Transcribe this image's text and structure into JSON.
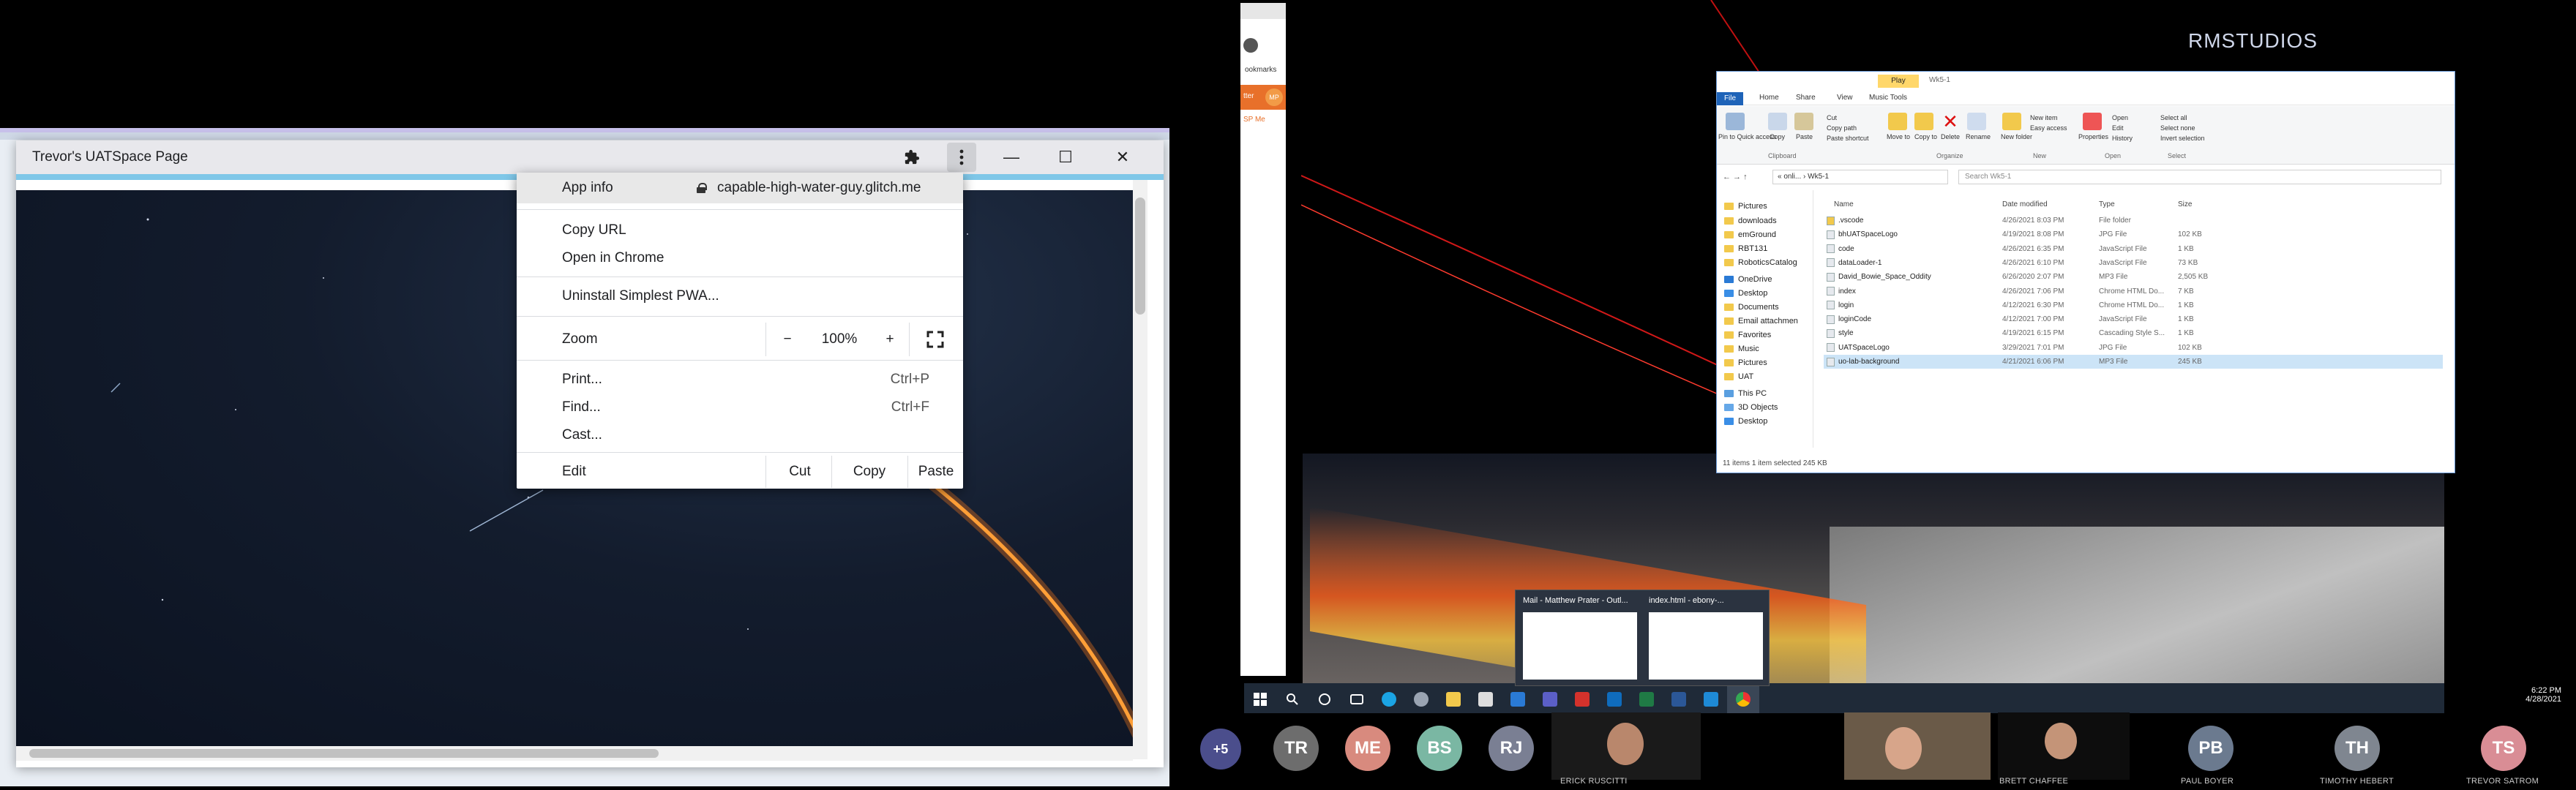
{
  "pwa_window": {
    "title": "Trevor's UATSpace Page",
    "extensions_icon": "puzzle-icon",
    "menu_icon": "three-dot-icon",
    "minimize_label": "—",
    "maximize_label": "☐",
    "close_label": "✕"
  },
  "context_menu": {
    "app_info": "App info",
    "url": "capable-high-water-guy.glitch.me",
    "copy_url": "Copy URL",
    "open_in_chrome": "Open in Chrome",
    "uninstall": "Uninstall Simplest PWA...",
    "zoom_label": "Zoom",
    "zoom_minus": "−",
    "zoom_value": "100%",
    "zoom_plus": "+",
    "print": "Print...",
    "print_shortcut": "Ctrl+P",
    "find": "Find...",
    "find_shortcut": "Ctrl+F",
    "cast": "Cast...",
    "edit": "Edit",
    "cut": "Cut",
    "copy": "Copy",
    "paste": "Paste"
  },
  "desktop": {
    "brand": "RMSTUDIOS"
  },
  "chrome_side": {
    "bookmarks": "ookmarks",
    "tab_a": "tter",
    "tab_b": "MP",
    "tab_c": "SP Me"
  },
  "explorer": {
    "quick_title": "Play",
    "path_title": "Wk5-1",
    "tabs": [
      "File",
      "Home",
      "Share",
      "View",
      "Music Tools"
    ],
    "ribbon": {
      "pin": "Pin to Quick access",
      "copy": "Copy",
      "paste": "Paste",
      "cut": "Cut",
      "copy_path": "Copy path",
      "paste_shortcut": "Paste shortcut",
      "move_to": "Move to",
      "copy_to": "Copy to",
      "delete": "Delete",
      "rename": "Rename",
      "new_folder": "New folder",
      "new_item": "New item",
      "easy_access": "Easy access",
      "properties": "Properties",
      "open": "Open",
      "edit": "Edit",
      "history": "History",
      "select_all": "Select all",
      "select_none": "Select none",
      "invert_selection": "Invert selection",
      "groups": [
        "Clipboard",
        "Organize",
        "New",
        "Open",
        "Select"
      ]
    },
    "breadcrumb": "« onli... › Wk5-1",
    "search_placeholder": "Search Wk5-1",
    "nav": [
      "Pictures",
      "downloads",
      "emGround",
      "RBT131",
      "RoboticsCatalog",
      "OneDrive",
      "Desktop",
      "Documents",
      "Email attachmen",
      "Favorites",
      "Music",
      "Pictures",
      "UAT",
      "This PC",
      "3D Objects",
      "Desktop"
    ],
    "columns": [
      "Name",
      "Date modified",
      "Type",
      "Size"
    ],
    "files": [
      {
        "name": ".vscode",
        "date": "4/26/2021 8:03 PM",
        "type": "File folder",
        "size": ""
      },
      {
        "name": "bhUATSpaceLogo",
        "date": "4/19/2021 8:08 PM",
        "type": "JPG File",
        "size": "102 KB"
      },
      {
        "name": "code",
        "date": "4/26/2021 6:35 PM",
        "type": "JavaScript File",
        "size": "1 KB"
      },
      {
        "name": "dataLoader-1",
        "date": "4/26/2021 6:10 PM",
        "type": "JavaScript File",
        "size": "73 KB"
      },
      {
        "name": "David_Bowie_Space_Oddity",
        "date": "6/26/2020 2:07 PM",
        "type": "MP3 File",
        "size": "2,505 KB"
      },
      {
        "name": "index",
        "date": "4/26/2021 7:06 PM",
        "type": "Chrome HTML Do...",
        "size": "7 KB"
      },
      {
        "name": "login",
        "date": "4/12/2021 6:30 PM",
        "type": "Chrome HTML Do...",
        "size": "1 KB"
      },
      {
        "name": "loginCode",
        "date": "4/12/2021 7:00 PM",
        "type": "JavaScript File",
        "size": "1 KB"
      },
      {
        "name": "style",
        "date": "4/19/2021 6:15 PM",
        "type": "Cascading Style S...",
        "size": "1 KB"
      },
      {
        "name": "UATSpaceLogo",
        "date": "3/29/2021 7:01 PM",
        "type": "JPG File",
        "size": "102 KB"
      },
      {
        "name": "uo-lab-background",
        "date": "4/21/2021 6:06 PM",
        "type": "MP3 File",
        "size": "245 KB"
      }
    ],
    "status": "11 items    1 item selected  245 KB"
  },
  "taskbar": {
    "time": "6:22 PM",
    "date": "4/28/2021",
    "thumb_mail": "Mail - Matthew Prater - Outl...",
    "thumb_index": "index.html - ebony-..."
  },
  "participants": {
    "more": "+5",
    "avatars": [
      {
        "initials": "TR",
        "color": "#6d6d6d"
      },
      {
        "initials": "ME",
        "color": "#d88a7e"
      },
      {
        "initials": "BS",
        "color": "#7ab7a3"
      },
      {
        "initials": "RJ",
        "color": "#7a7f93"
      },
      {
        "initials": "PB",
        "color": "#6b7a8f"
      },
      {
        "initials": "TH",
        "color": "#7f8690"
      },
      {
        "initials": "TS",
        "color": "#d98d95"
      }
    ],
    "names": {
      "erick": "ERICK RUSCITTI",
      "brett": "BRETT CHAFFEE",
      "paul": "PAUL BOYER",
      "timothy": "TIMOTHY HEBERT",
      "trevor": "TREVOR SATROM"
    },
    "more_color": "#4b4e8c"
  }
}
